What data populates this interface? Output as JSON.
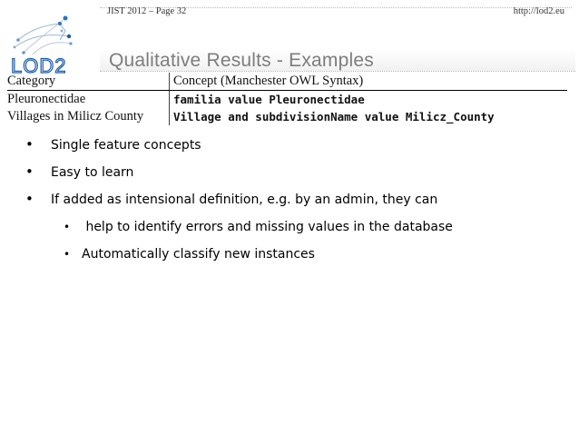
{
  "header": {
    "left_text": "JIST 2012 – Page 32",
    "right_text": "http://lod2.eu"
  },
  "logo": {
    "text": "LOD2",
    "accent_color": "#1a5aa8"
  },
  "slide": {
    "title": "Qualitative Results - Examples",
    "title_color": "#7d7d7d"
  },
  "table": {
    "headers": [
      "Category",
      "Concept (Manchester OWL Syntax)"
    ],
    "rows": [
      {
        "category": "Pleuronectidae",
        "concept": "familia value Pleuronectidae"
      },
      {
        "category": "Villages in Milicz County",
        "concept": "Village and subdivisionName value Milicz_County"
      }
    ]
  },
  "bullets": [
    {
      "symbol": "•",
      "text": "Single feature concepts"
    },
    {
      "symbol": "•",
      "text": "Easy to learn"
    },
    {
      "symbol": "•",
      "text": "If added as intensional definition, e.g. by an admin, they can"
    }
  ],
  "sub_bullets": [
    {
      "symbol": "•",
      "text": " help to identify errors and missing values in the database"
    },
    {
      "symbol": "•",
      "text": "Automatically classify new instances"
    }
  ]
}
